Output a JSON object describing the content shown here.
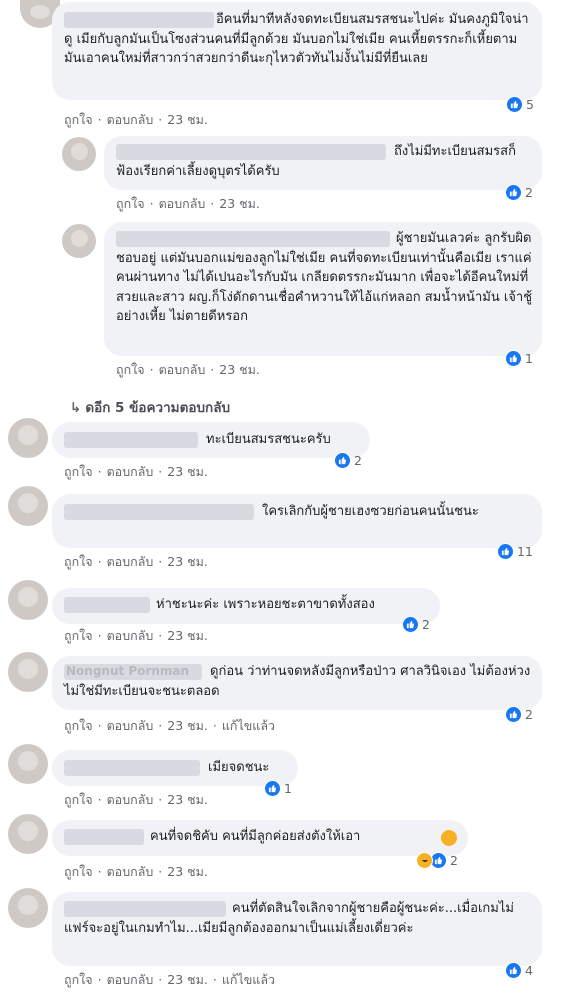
{
  "actions": {
    "like": "ถูกใจ",
    "reply": "ตอบกลับ",
    "edited": "แก้ไขแล้ว"
  },
  "more_replies": "ดอีก 5 ข้อความตอบกลับ",
  "comments": [
    {
      "text": "อีคนที่มาทีหลังจดทะเบียนสมรสชนะไปค่ะ มันคงภูมิใจน่าดู เมียกับลูกมันเป็นโซงส่วนคนที่มีลูกด้วย มันบอกไม่ใช่เมีย คนเหี้ยตรรกะก็เหี้ยตาม มันเอาคนใหม่ที่สาวกว่าสวยกว่าดีนะกุไหวตัวทันไม่งั้นไม่มีที่ยืนเลย",
      "time": "23 ชม.",
      "likes": "5"
    },
    {
      "text": "ถึงไม่มีทะเบียนสมรสก็ฟ้องเรียกค่าเลี้ยงดูบุตรได้ครับ",
      "time": "23 ชม.",
      "likes": "2"
    },
    {
      "text": "ผู้ชายมันเลวค่ะ ลูกรับผิดชอบอยู่ แต่มันบอกแม่ของลูกไม่ใช่เมีย คนที่จดทะเบียนเท่านั้นคือเมีย เราแค่คนผ่านทาง ไม่ได้เปนอะไรกับมัน เกลียดตรรกะมันมาก เพื่อจะได้อีคนใหม่ที่สวยและสาว ผญ.ก็โง่ดักดานเชื่อคำหวานให้ไอ้แก่หลอก สมน้ำหน้ามัน เจ้าชู้อย่างเหี้ย ไม่ตายดีหรอก",
      "time": "23 ชม.",
      "likes": "1"
    },
    {
      "text": "ทะเบียนสมรสชนะครับ",
      "time": "23 ชม.",
      "likes": "2"
    },
    {
      "text": "ใครเลิกกับผู้ชายเฮงซวยก่อนคนนั้นชนะ",
      "time": "23 ชม.",
      "likes": "11"
    },
    {
      "text": "ห่าชะนะค่ะ เพราะหอยชะตาขาดทั้งสอง",
      "time": "23 ชม.",
      "likes": "2"
    },
    {
      "name": "Nongnut Pornman",
      "text": "ดูก่อน ว่าท่านจดหลังมีลูกหรือป่าว ศาลวินิจเอง ไม่ต้องห่วง ไม่ใช่มีทะเบียนจะชนะตลอด",
      "time": "23 ชม.",
      "likes": "2"
    },
    {
      "text": "เมียจดชนะ",
      "time": "23 ชม.",
      "likes": "1"
    },
    {
      "text": "คนที่จดชิคับ คนที่มีลูกค่อยส่งตังให้เอา",
      "time": "23 ชม.",
      "likes": "2"
    },
    {
      "text": "คนที่ตัดสินใจเลิกจากผู้ชายคือผู้ชนะค่ะ...เมื่อเกมไม่แฟร์จะอยู่ในเกมทำไม...เมียมีลูกต้องออกมาเป็นแม่เลี้ยงเดี่ยวค่ะ",
      "time": "23 ชม.",
      "likes": "4"
    }
  ],
  "colors": {
    "like_blue": "#1877f2",
    "bubble": "#f0f2f5",
    "meta": "#65676b",
    "haha": "#f7b125"
  }
}
